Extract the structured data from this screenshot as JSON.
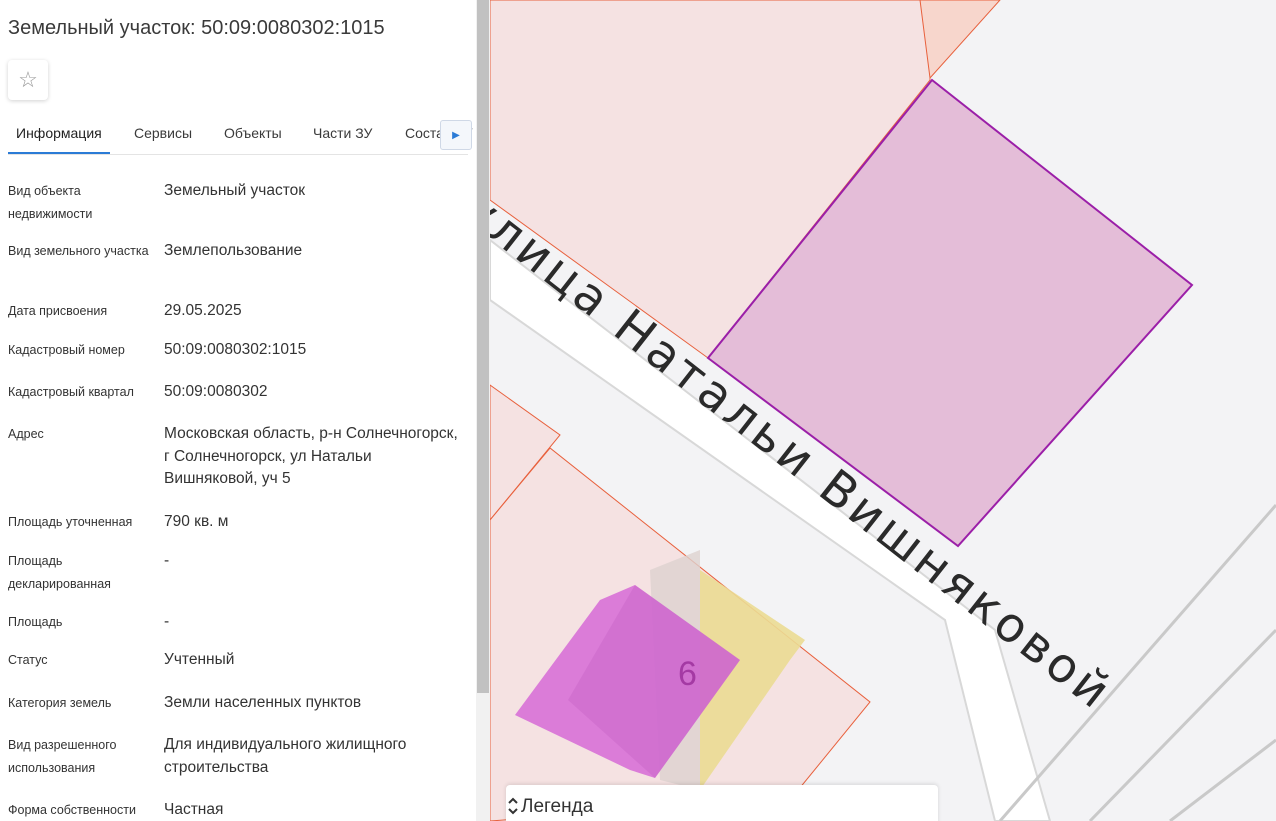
{
  "panel": {
    "title": "Земельный участок: 50:09:0080302:1015",
    "favorite_icon": "star-outline-icon",
    "tabs": [
      {
        "label": "Информация",
        "active": true
      },
      {
        "label": "Сервисы"
      },
      {
        "label": "Объекты"
      },
      {
        "label": "Части ЗУ"
      },
      {
        "label": "Состав ЗУ"
      }
    ],
    "tabs_scroll_icon": "chevron-right-icon",
    "properties": [
      {
        "label": "Вид объекта недвижимости",
        "value": "Земельный участок"
      },
      {
        "label": "Вид земельного участка",
        "value": "Землепользование"
      },
      {
        "label": "Дата присвоения",
        "value": "29.05.2025"
      },
      {
        "label": "Кадастровый номер",
        "value": "50:09:0080302:1015"
      },
      {
        "label": "Кадастровый квартал",
        "value": "50:09:0080302"
      },
      {
        "label": "Адрес",
        "value": "Московская область, р-н Солнечногорск, г Солнечногорск, ул Натальи Вишняковой, уч 5"
      },
      {
        "label": "Площадь уточненная",
        "value": "790 кв. м"
      },
      {
        "label": "Площадь декларированная",
        "value": "-"
      },
      {
        "label": "Площадь",
        "value": "-"
      },
      {
        "label": "Статус",
        "value": "Учтенный"
      },
      {
        "label": "Категория земель",
        "value": "Земли населенных пунктов"
      },
      {
        "label": "Вид разрешенного использования",
        "value": "Для индивидуального жилищного строительства"
      },
      {
        "label": "Форма собственности",
        "value": "Частная"
      }
    ]
  },
  "map": {
    "street_label": "улица Натальи Вишняковой",
    "parcel_number": "6",
    "colors": {
      "selected_fill": "#e4bdd8",
      "selected_stroke": "#9b1fa8",
      "parcel_fill": "#f5e2e2",
      "parcel_stroke": "#e8603c",
      "building_fill": "#d66ad6",
      "yellow_zone": "#ebe79a",
      "background": "#f3f3f5"
    },
    "legend": {
      "label": "Легенда",
      "icon": "expand-collapse-icon"
    }
  }
}
